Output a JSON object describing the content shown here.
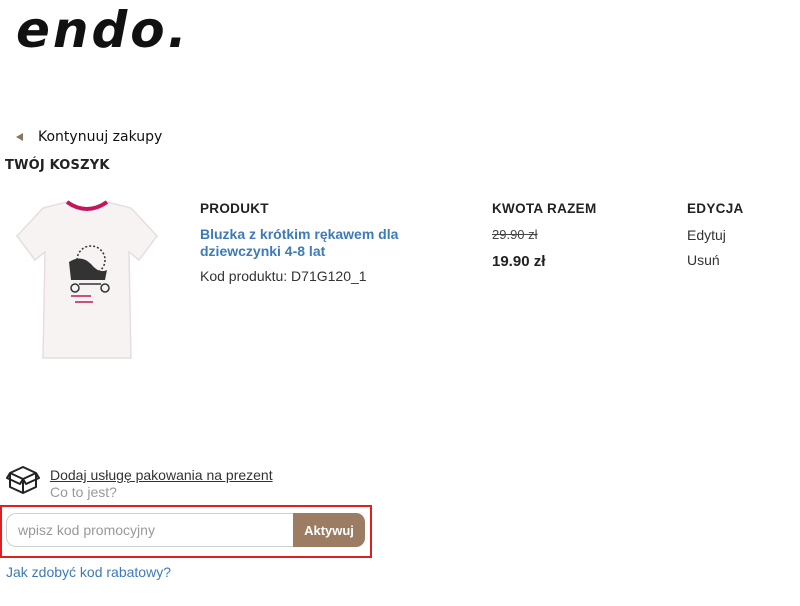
{
  "header": {
    "logo_text": "endo."
  },
  "nav": {
    "continue_label": "Kontynuuj zakupy"
  },
  "cart": {
    "title": "TWÓJ KOSZYK",
    "columns": {
      "product": "PRODUKT",
      "total": "KWOTA RAZEM",
      "edit": "EDYCJA"
    },
    "item": {
      "name": "Bluzka z krótkim rękawem dla dziewczynki 4-8 lat",
      "code_label": "Kod produktu: D71G120_1",
      "price_old": "29.90 zł",
      "price_new": "19.90 zł",
      "edit_label": "Edytuj",
      "remove_label": "Usuń",
      "image_icon": "tshirt-icon"
    }
  },
  "gift": {
    "link_label": "Dodaj usługę pakowania na prezent",
    "info_label": "Co to jest?",
    "icon": "box-icon"
  },
  "promo": {
    "placeholder": "wpisz kod promocyjny",
    "value": "",
    "button_label": "Aktywuj",
    "help_link": "Jak zdobyć kod rabatowy?"
  },
  "colors": {
    "accent_brown": "#9c7c62",
    "link_blue": "#3d7ab8",
    "highlight_red": "#e02020"
  }
}
